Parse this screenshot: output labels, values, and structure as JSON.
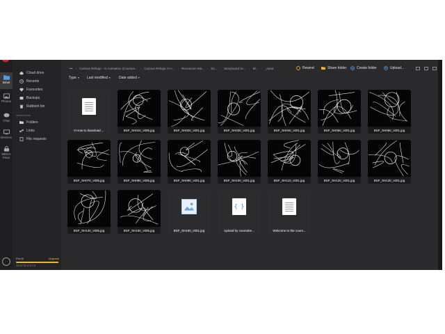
{
  "rail": {
    "items": [
      {
        "label": "Drive",
        "icon": "folder-icon"
      },
      {
        "label": "Photos",
        "icon": "photos-icon"
      },
      {
        "label": "Chat",
        "icon": "chat-icon"
      },
      {
        "label": "Devices",
        "icon": "devices-icon"
      },
      {
        "label": "MEGA Pass",
        "icon": "pass-icon"
      }
    ]
  },
  "nav": {
    "items": [
      {
        "label": "Cloud drive",
        "icon": "cloud-icon"
      },
      {
        "label": "Recents",
        "icon": "clock-icon"
      },
      {
        "label": "Favourites",
        "icon": "heart-icon"
      },
      {
        "label": "Backups",
        "icon": "backup-icon"
      },
      {
        "label": "Rubbish bin",
        "icon": "trash-icon"
      }
    ],
    "shared_heading": "Shared items",
    "shared_items": [
      {
        "label": "Folders",
        "icon": "folder-icon"
      },
      {
        "label": "Links",
        "icon": "link-icon"
      },
      {
        "label": "File requests",
        "icon": "file-request-icon"
      }
    ],
    "storage": {
      "plan": "Pro III",
      "upgrade": "Upgrade",
      "usage": "15.99 TB of 16 TB",
      "used_fraction": 0.99
    }
  },
  "breadcrumb": {
    "items": [
      "•••",
      "Curious Refuge - AI Animation (Courses...",
      "Curious Refuge AI A...",
      "Resources Ma...",
      "Es...",
      "Storyboard Sc...",
      "Bl...",
      "_Input"
    ]
  },
  "toolbar": {
    "rewind": "Rewind",
    "share_folder": "Share folder",
    "create_folder": "Create folder",
    "upload": "Upload..."
  },
  "filters": {
    "type": "Type",
    "last_modified": "Last modified",
    "date_added": "Date added"
  },
  "files": [
    {
      "name": "0 How to download ...",
      "kind": "doc"
    },
    {
      "name": "BSF_SH010_v005.jpg",
      "kind": "sketch"
    },
    {
      "name": "BSF_SH020_v001.jpg",
      "kind": "sketch"
    },
    {
      "name": "BSF_SH030_v001.jpg",
      "kind": "sketch"
    },
    {
      "name": "BSF_SH040_v001.jpg",
      "kind": "sketch"
    },
    {
      "name": "BSF_SH050_v001.jpg",
      "kind": "sketch"
    },
    {
      "name": "BSF_SH060_v001.jpg",
      "kind": "sketch"
    },
    {
      "name": "BSF_SH070_v005.jpg",
      "kind": "sketch"
    },
    {
      "name": "BSF_SH080_v005.jpg",
      "kind": "sketch"
    },
    {
      "name": "BSF_SH090_v001.jpg",
      "kind": "sketch"
    },
    {
      "name": "BSF_SH100_v001.jpg",
      "kind": "sketch"
    },
    {
      "name": "BSF_SH110_v001.jpg",
      "kind": "sketch"
    },
    {
      "name": "BSF_SH120_v001.jpg",
      "kind": "sketch"
    },
    {
      "name": "BSF_SH130_v001.jpg",
      "kind": "sketch"
    },
    {
      "name": "BSF_SH140_v005.jpg",
      "kind": "sketch"
    },
    {
      "name": "BSF_SH150_v005.jpg",
      "kind": "sketch"
    },
    {
      "name": "BSF_SH160_v001.jpg",
      "kind": "image"
    },
    {
      "name": "Upload by coursebe...",
      "kind": "code"
    },
    {
      "name": "Welcome to the cours...",
      "kind": "doc"
    }
  ],
  "colors": {
    "accent": "#f0b429",
    "brand": "#d9272e",
    "background": "#2a2a2c"
  }
}
